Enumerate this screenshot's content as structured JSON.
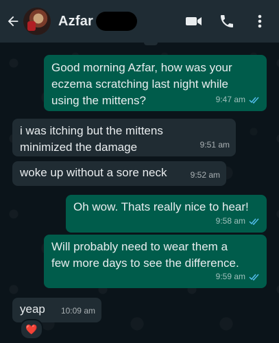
{
  "header": {
    "back_icon": "arrow-left-icon",
    "contact_name": "Azfar",
    "video_icon": "video-call-icon",
    "phone_icon": "phone-icon",
    "menu_icon": "more-vert-icon"
  },
  "messages": [
    {
      "direction": "outgoing",
      "text": "Good morning Azfar, how was your\neczema scratching last night while\nusing the mittens?",
      "time": "9:47 am",
      "status": "read"
    },
    {
      "direction": "incoming",
      "text": "i was itching but the mittens\nminimized the damage",
      "time": "9:51 am"
    },
    {
      "direction": "incoming",
      "text": "woke up without a sore neck",
      "time": "9:52 am"
    },
    {
      "direction": "outgoing",
      "text": "Oh wow. Thats really nice to hear!",
      "time": "9:58 am",
      "status": "read"
    },
    {
      "direction": "outgoing",
      "text": "Will probably need to wear them a\nfew more days to see the difference.",
      "time": "9:59 am",
      "status": "read"
    },
    {
      "direction": "incoming",
      "text": "yeap",
      "time": "10:09 am",
      "reaction": "❤️"
    }
  ],
  "colors": {
    "outgoing_bubble": "#005c4b",
    "incoming_bubble": "#202c33",
    "read_ticks": "#53bdeb",
    "header": "#1f2c34"
  }
}
